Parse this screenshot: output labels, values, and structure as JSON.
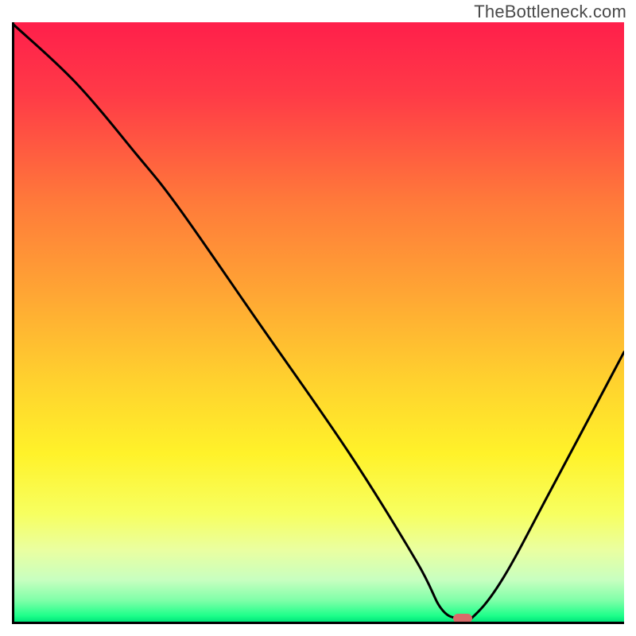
{
  "watermark": "TheBottleneck.com",
  "chart_data": {
    "type": "line",
    "title": "",
    "xlabel": "",
    "ylabel": "",
    "xlim": [
      0,
      100
    ],
    "ylim": [
      0,
      100
    ],
    "x": [
      0,
      10,
      20,
      27,
      40,
      55,
      66,
      70,
      73,
      75,
      80,
      88,
      100
    ],
    "y": [
      99.5,
      90,
      78,
      69,
      50,
      28,
      10,
      2.2,
      0.5,
      0.6,
      7,
      22,
      45
    ],
    "marker": {
      "x": 73.5,
      "y": 0.5,
      "color": "#d86a6a"
    },
    "gradient_stops": [
      {
        "offset": 0.0,
        "color": "#ff1f4b"
      },
      {
        "offset": 0.12,
        "color": "#ff3a47"
      },
      {
        "offset": 0.3,
        "color": "#ff7a3a"
      },
      {
        "offset": 0.45,
        "color": "#ffa534"
      },
      {
        "offset": 0.6,
        "color": "#ffd22e"
      },
      {
        "offset": 0.72,
        "color": "#fff22a"
      },
      {
        "offset": 0.82,
        "color": "#f7ff60"
      },
      {
        "offset": 0.88,
        "color": "#eaffa0"
      },
      {
        "offset": 0.93,
        "color": "#c8ffc0"
      },
      {
        "offset": 0.965,
        "color": "#7effa8"
      },
      {
        "offset": 0.99,
        "color": "#1eff8a"
      },
      {
        "offset": 1.0,
        "color": "#00e57a"
      }
    ]
  }
}
